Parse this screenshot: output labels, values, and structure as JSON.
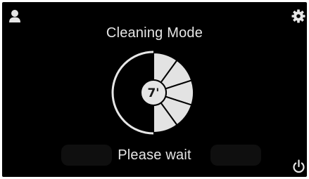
{
  "screen": {
    "title": "Cleaning Mode",
    "status": "Please wait"
  },
  "timer": {
    "label": "7'",
    "progress_fraction": 0.5
  },
  "icons": {
    "user": "user-icon",
    "settings": "gear-icon",
    "power": "power-icon"
  },
  "colors": {
    "background": "#000000",
    "text": "#e6e6e6",
    "segment_fill": "#e3e3e3",
    "segment_border": "#000000",
    "remaining_arc": "#e6e6e6"
  }
}
